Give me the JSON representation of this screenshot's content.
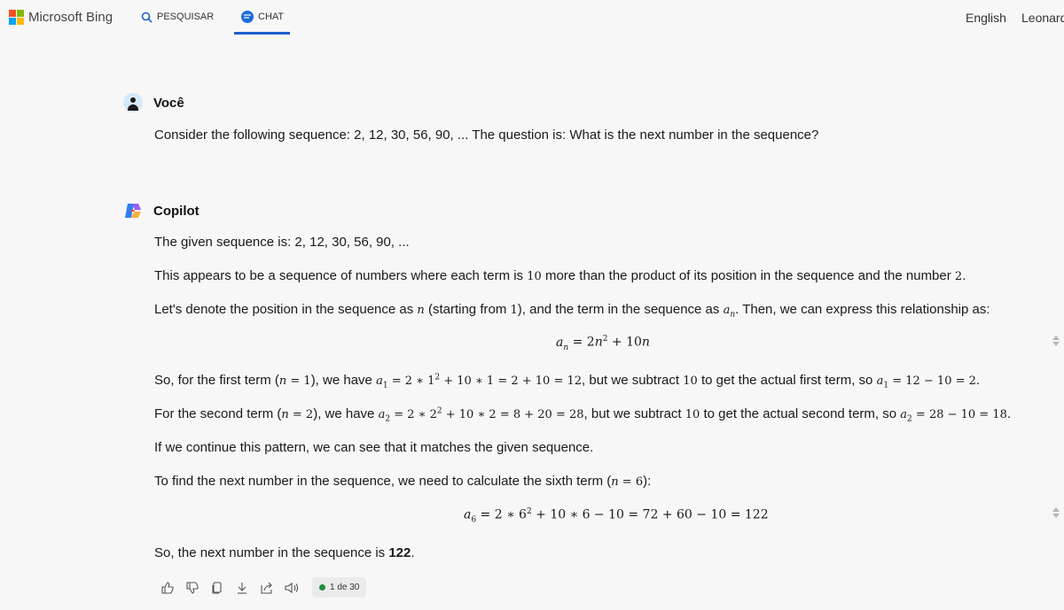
{
  "topbar": {
    "brand": "Microsoft Bing",
    "tabs": [
      {
        "label": "PESQUISAR",
        "icon": "search-icon"
      },
      {
        "label": "CHAT",
        "icon": "chat-icon",
        "active": true
      }
    ],
    "language": "English",
    "user": "Leonard"
  },
  "colors": {
    "accent": "#1d5fcc",
    "logo": [
      "#f25022",
      "#7fba00",
      "#00a4ef",
      "#ffb900"
    ]
  },
  "user_message": {
    "author": "Você",
    "text": "Consider the following sequence: 2, 12, 30, 56, 90, ... The question is: What is the next number in the sequence?"
  },
  "copilot_message": {
    "author": "Copilot",
    "p1": "The given sequence is: 2, 12, 30, 56, 90, ...",
    "p2": {
      "a": "This appears to be a sequence of numbers where each term is ",
      "b": "10",
      "c": " more than the product of its position in the sequence and the number ",
      "d": "2",
      "e": "."
    },
    "p3": {
      "a": "Let's denote the position in the sequence as ",
      "b": " (starting from ",
      "c": "1",
      "d": "), and the term in the sequence as ",
      "e": ". Then, we can express this relationship as:"
    },
    "p4": {
      "a": "So, for the first term (",
      "b": "), we have ",
      "c": ", but we subtract ",
      "d": " to get the actual first term, so "
    },
    "p5": {
      "a": "For the second term (",
      "b": "), we have ",
      "c": ", but we subtract ",
      "d": " to get the actual second term, so "
    },
    "p6": "If we continue this pattern, we can see that it matches the given sequence.",
    "p7": {
      "a": "To find the next number in the sequence, we need to calculate the sixth term ("
    },
    "p8": {
      "a": "So, the next number in the sequence is ",
      "b": "122",
      "c": "."
    },
    "counter": "1 de 30"
  }
}
